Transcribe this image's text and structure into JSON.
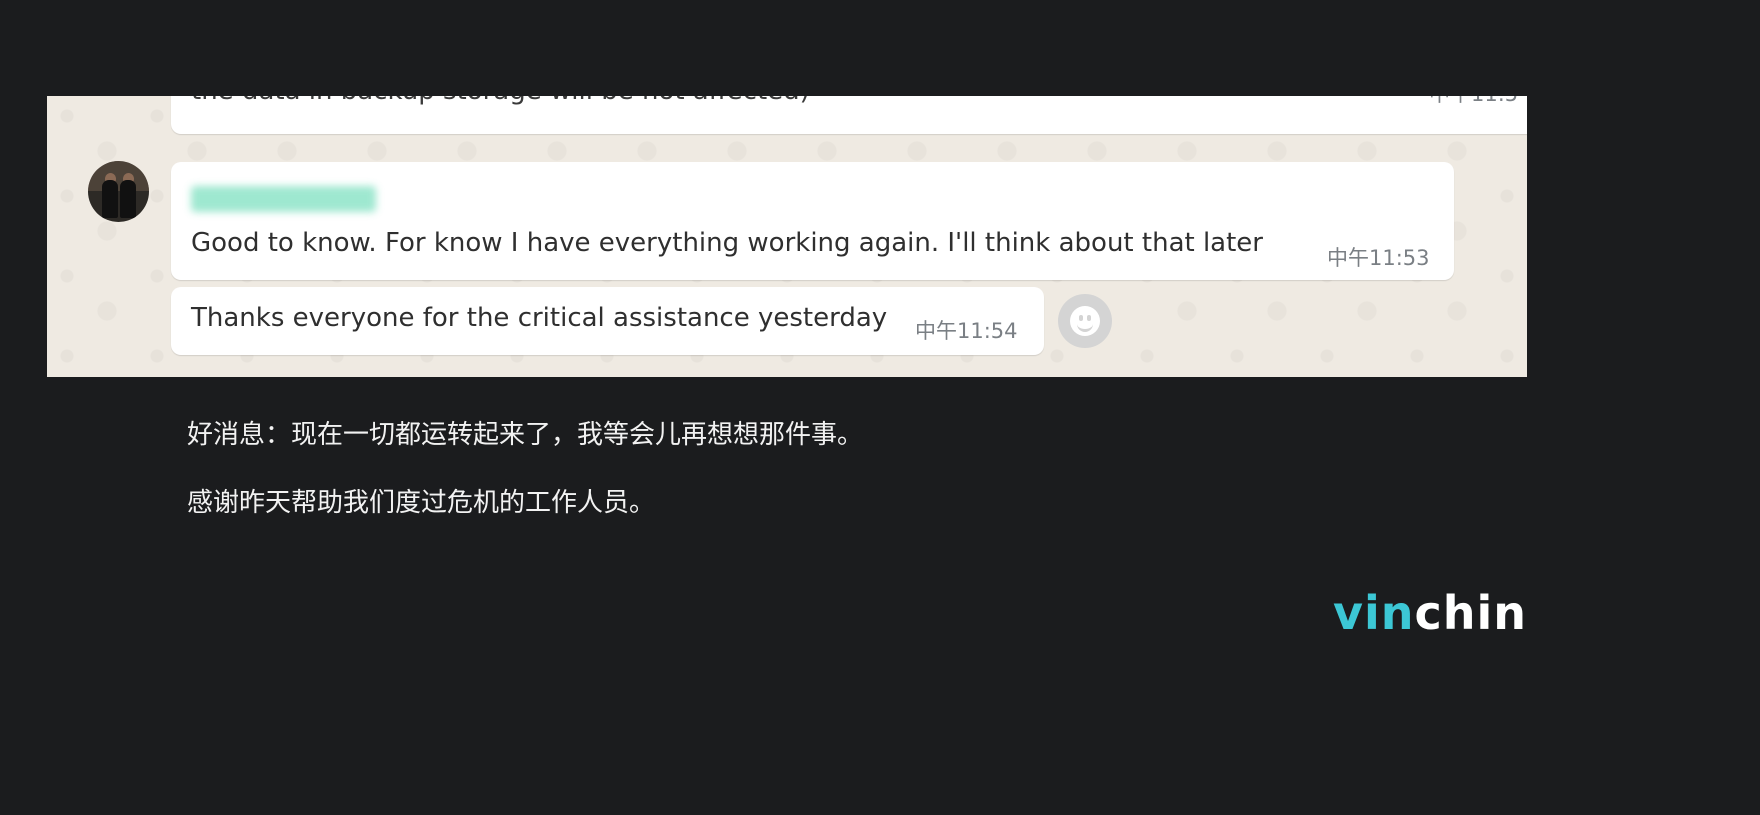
{
  "chat": {
    "messages": [
      {
        "text": "the data in backup storage will be not affected)",
        "time": "中午11:5"
      },
      {
        "sender": "",
        "text": "Good to know. For know I have everything working again. I'll think about that later",
        "time": "中午11:53"
      },
      {
        "text": "Thanks everyone for the critical assistance yesterday",
        "time": "中午11:54"
      }
    ],
    "emoji_icon": "smiley-icon"
  },
  "translation": {
    "line1": "好消息：现在一切都运转起来了，我等会儿再想想那件事。",
    "line2": "感谢昨天帮助我们度过危机的工作人员。"
  },
  "logo": {
    "part1": "vin",
    "part2": "chin",
    "accent_color": "#3cc7d5"
  },
  "colors": {
    "page_bg": "#1b1c1e",
    "chat_bg": "#efeae2",
    "bubble_bg": "#ffffff"
  }
}
